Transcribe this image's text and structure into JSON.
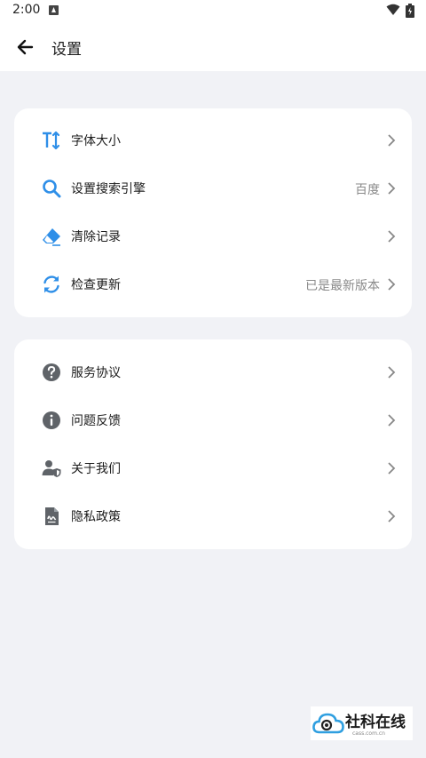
{
  "status_bar": {
    "time": "2:00"
  },
  "app_bar": {
    "title": "设置"
  },
  "group1": [
    {
      "label": "字体大小",
      "value": "",
      "icon": "text-size-icon"
    },
    {
      "label": "设置搜索引擎",
      "value": "百度",
      "icon": "search-icon"
    },
    {
      "label": "清除记录",
      "value": "",
      "icon": "eraser-icon"
    },
    {
      "label": "检查更新",
      "value": "已是最新版本",
      "icon": "refresh-icon"
    }
  ],
  "group2": [
    {
      "label": "服务协议",
      "value": "",
      "icon": "question-icon"
    },
    {
      "label": "问题反馈",
      "value": "",
      "icon": "info-icon"
    },
    {
      "label": "关于我们",
      "value": "",
      "icon": "user-shield-icon"
    },
    {
      "label": "隐私政策",
      "value": "",
      "icon": "document-icon"
    }
  ],
  "watermark": {
    "text": "社科在线",
    "subtext": "cass.com.cn"
  },
  "colors": {
    "accent": "#2f8fe8",
    "gray_icon": "#5f6368",
    "background": "#f1f2f6"
  }
}
